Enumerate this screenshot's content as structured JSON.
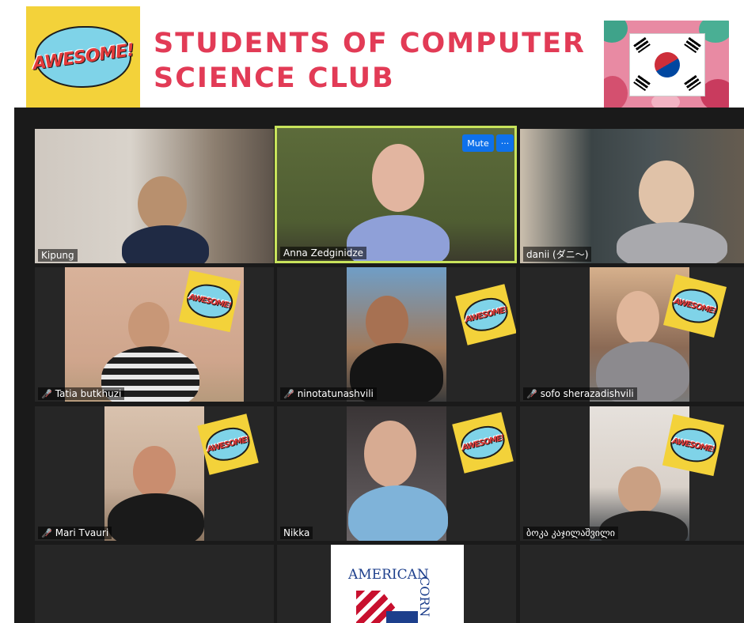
{
  "header": {
    "logo_word": "AWESOME!",
    "title_line1": "STUDENTS OF COMPUTER",
    "title_line2": "SCIENCE CLUB"
  },
  "meeting": {
    "mute_label": "Mute",
    "more_label": "···",
    "participants": [
      {
        "name": "Kipung",
        "muted": false
      },
      {
        "name": "Anna Zedginidze",
        "muted": false,
        "active_speaker": true
      },
      {
        "name": "danii (ダニ〜)",
        "muted": false
      },
      {
        "name": "Tatia butkhuzi",
        "muted": true
      },
      {
        "name": "ninotatunashvili",
        "muted": true
      },
      {
        "name": "sofo sherazadishvili",
        "muted": true
      },
      {
        "name": "Mari Tvauri",
        "muted": true
      },
      {
        "name": "Nikka",
        "muted": false
      },
      {
        "name": "ბოკა კაჯილაშვილი",
        "muted": false
      }
    ],
    "sticker_word": "AWESOME!",
    "logo_card": {
      "line1": "AMERICAN",
      "vertical": "CORN"
    }
  },
  "colors": {
    "title": "#e23b56",
    "active_border": "#c8e35b",
    "button": "#0e71eb",
    "sticker": "#f3d23a"
  }
}
